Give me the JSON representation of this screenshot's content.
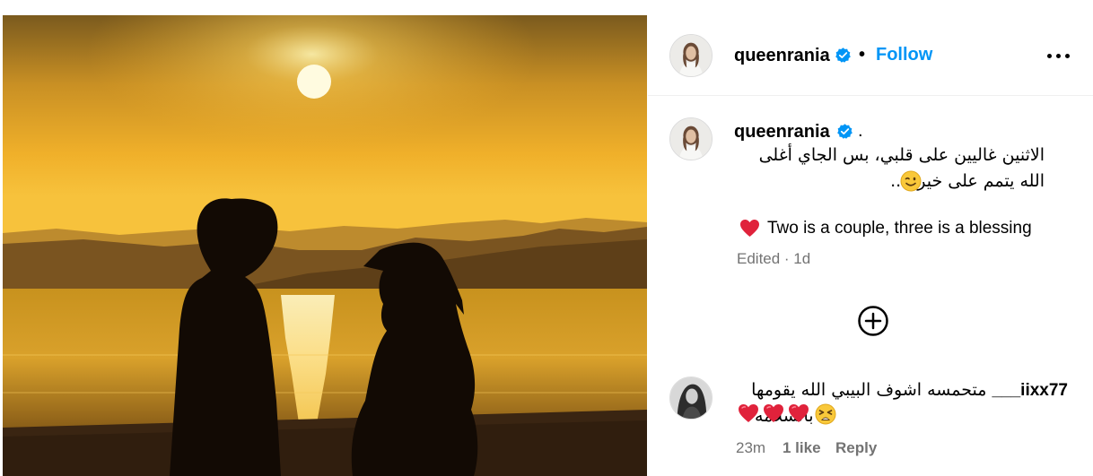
{
  "post": {
    "username": "queenrania",
    "follow_label": "Follow",
    "separator": "•",
    "more_icon": "more-horizontal-icon",
    "verified_icon": "verified-badge-icon",
    "photo_alt": "silhouette-couple-at-sunset-photo"
  },
  "caption": {
    "username": "queenrania",
    "trailing_dot": ".",
    "arabic_line1": "الاثنين غاليين على قلبي، بس الجاي أغلى",
    "arabic_line2": "الله يتمم على خير.....",
    "wink_emoji": "winking-face-emoji",
    "heart_emoji": "red-heart-emoji",
    "english_text": "Two is a couple, three is a blessing",
    "edited_label": "Edited · 1d"
  },
  "load_more_icon": "plus-circle-icon",
  "comment": {
    "username": "iixx77___",
    "text_line1": "متحمسه اشوف البيبي الله يقومها",
    "text_line2": "بالسلامه",
    "emojis": [
      "tired-face-emoji",
      "red-heart-emoji",
      "red-heart-emoji",
      "red-heart-emoji"
    ],
    "time": "23m",
    "likes": "1 like",
    "reply_label": "Reply"
  },
  "colors": {
    "accent": "#0095f6",
    "muted_text": "#737373",
    "border": "#efefef",
    "verified": "#0095f6"
  }
}
